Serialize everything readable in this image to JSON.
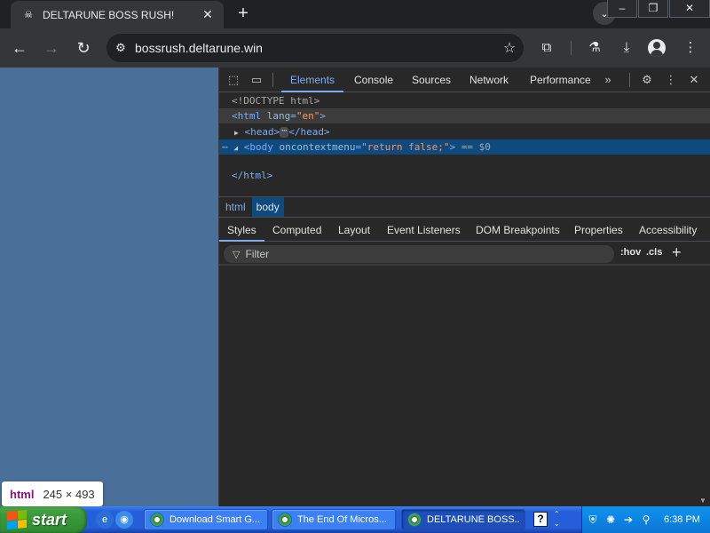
{
  "browser": {
    "tab_title": "DELTARUNE BOSS RUSH!",
    "url": "bossrush.deltarune.win"
  },
  "devtools": {
    "tabs": [
      "Elements",
      "Console",
      "Sources",
      "Network",
      "Performance"
    ],
    "dom": {
      "doctype": "<!DOCTYPE html>",
      "html_open_tag": "<html",
      "html_attr": "lang",
      "html_attr_val": "\"en\"",
      "html_close": ">",
      "head_open": "<head>",
      "head_ellipsis": "⋯",
      "head_close": "</head>",
      "body_tag": "<body",
      "body_attr": "oncontextmenu",
      "body_attr_val": "\"return false;\"",
      "body_close": ">",
      "body_eq": "== $0",
      "html_end": "</html>"
    },
    "breadcrumbs": [
      "html",
      "body"
    ],
    "style_tabs": [
      "Styles",
      "Computed",
      "Layout",
      "Event Listeners",
      "DOM Breakpoints",
      "Properties",
      "Accessibility"
    ],
    "filter_placeholder": "Filter",
    "hov_label": ":hov",
    "cls_label": ".cls"
  },
  "element_tooltip": {
    "tag": "html",
    "size": "245 × 493"
  },
  "taskbar": {
    "start_label": "start",
    "buttons": [
      "Download Smart G...",
      "The End Of Micros...",
      "DELTARUNE BOSS..."
    ],
    "clock": "6:38 PM"
  },
  "colors": {
    "page_background": "#4a6f99",
    "devtools_accent": "#7cacf8",
    "selected_row": "#0f4a7e",
    "xp_taskbar": "#245edb",
    "xp_start": "#3c9a3c"
  }
}
